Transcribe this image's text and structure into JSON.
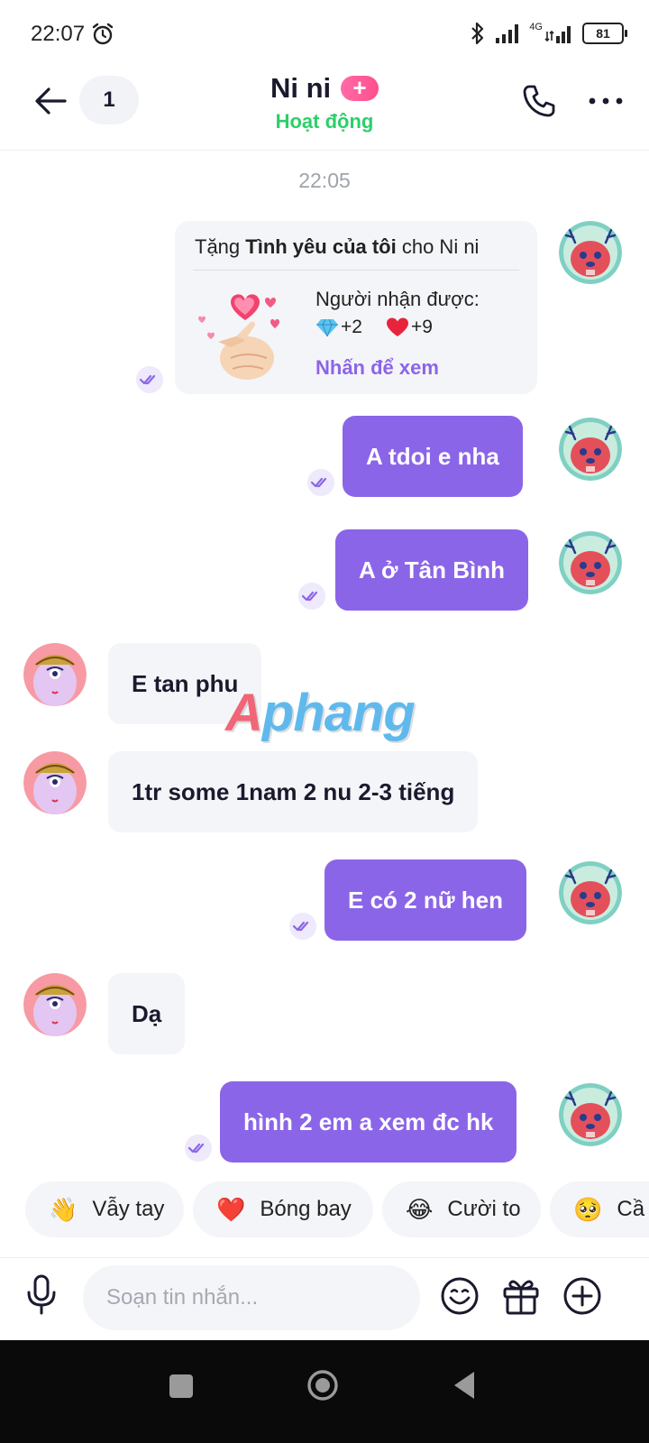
{
  "status_bar": {
    "time": "22:07",
    "network_label": "4G",
    "battery": "81"
  },
  "header": {
    "unread_count": "1",
    "contact_name": "Ni ni",
    "add_badge": "+",
    "status": "Hoạt động"
  },
  "chat": {
    "timestamp": "22:05",
    "gift_card": {
      "title_prefix": "Tặng ",
      "gift_name": "Tình yêu của tôi",
      "title_suffix": " cho Ni ni",
      "received_label": "Người nhận được:",
      "diamond_reward": "+2",
      "heart_reward": "+9",
      "view_link": "Nhấn để xem"
    },
    "messages": [
      {
        "direction": "out",
        "text": "A tdoi e nha"
      },
      {
        "direction": "out",
        "text": "A ở Tân Bình"
      },
      {
        "direction": "in",
        "text": "E tan phu"
      },
      {
        "direction": "in",
        "text": "1tr some 1nam 2 nu 2-3 tiếng"
      },
      {
        "direction": "out",
        "text": "E có 2 nữ hen"
      },
      {
        "direction": "in",
        "text": "Dạ"
      },
      {
        "direction": "out",
        "text": "hình 2 em a xem đc hk"
      }
    ],
    "watermark": {
      "first": "A",
      "rest": "phang"
    }
  },
  "reactions": [
    {
      "emoji": "👋",
      "label": "Vẫy tay"
    },
    {
      "emoji": "❤️",
      "label": "Bóng bay"
    },
    {
      "emoji": "😂",
      "label": "Cười to"
    },
    {
      "emoji": "🥺",
      "label": "Cầ"
    }
  ],
  "composer": {
    "placeholder": "Soạn tin nhắn..."
  },
  "colors": {
    "accent": "#8b65e8",
    "online": "#2dcf6a",
    "incoming_bubble": "#f4f5f8"
  }
}
